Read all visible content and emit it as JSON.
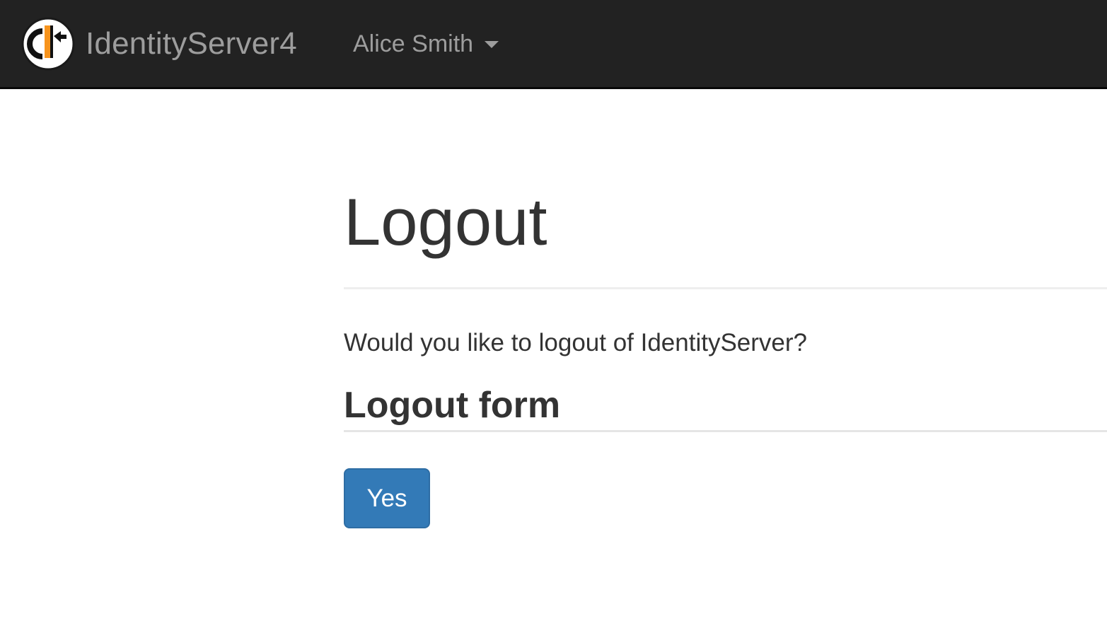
{
  "navbar": {
    "brand_name": "IdentityServer4",
    "brand_logo_icon": "identityserver-logo-icon",
    "user_menu": {
      "name": "Alice Smith",
      "icon": "caret-down-icon"
    }
  },
  "main": {
    "title": "Logout",
    "question": "Would you like to logout of IdentityServer?",
    "form": {
      "legend": "Logout form",
      "submit_label": "Yes"
    }
  },
  "colors": {
    "navbar_background": "#222222",
    "navbar_text": "#9d9d9d",
    "primary_button": "#337ab7",
    "logo_accent": "#f7941d"
  }
}
